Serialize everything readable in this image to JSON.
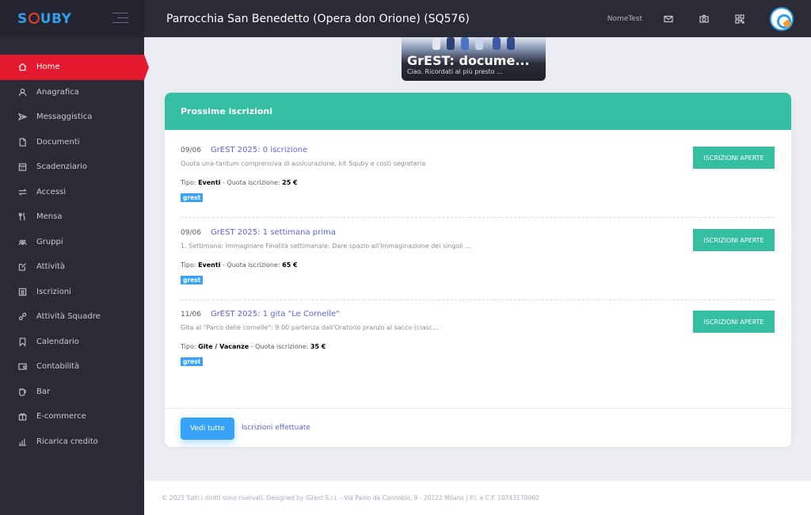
{
  "app": {
    "logo": "SQUBY"
  },
  "header": {
    "org_name": "Parrocchia San Benedetto (Opera don Orione) (SQ576)",
    "username": "NomeTest",
    "icons": [
      "mail-icon",
      "camera-icon",
      "qr-code-icon"
    ]
  },
  "sidebar": {
    "items": [
      {
        "label": "Home",
        "icon": "home-icon"
      },
      {
        "label": "Anagrafica",
        "icon": "user-icon"
      },
      {
        "label": "Messaggistica",
        "icon": "send-icon"
      },
      {
        "label": "Documenti",
        "icon": "document-icon"
      },
      {
        "label": "Scadenziario",
        "icon": "calendar-grid-icon"
      },
      {
        "label": "Accessi",
        "icon": "arrows-icon"
      },
      {
        "label": "Mensa",
        "icon": "cutlery-icon"
      },
      {
        "label": "Gruppi",
        "icon": "group-icon"
      },
      {
        "label": "Attività",
        "icon": "edit-icon"
      },
      {
        "label": "Iscrizioni",
        "icon": "list-icon"
      },
      {
        "label": "Attività Squadre",
        "icon": "link-icon"
      },
      {
        "label": "Calendario",
        "icon": "bookmark-icon"
      },
      {
        "label": "Contabilità",
        "icon": "wallet-icon"
      },
      {
        "label": "Bar",
        "icon": "cup-icon"
      },
      {
        "label": "E-commerce",
        "icon": "gift-icon"
      },
      {
        "label": "Ricarica credito",
        "icon": "chart-icon"
      }
    ]
  },
  "banner": {
    "title": "GrEST: docume...",
    "subtitle": "Ciao. Ricordati al più presto ..."
  },
  "panel": {
    "title": "Prossime iscrizioni",
    "entries": [
      {
        "date": "09/06",
        "title": "GrEST 2025: 0 iscrizione",
        "description": "Quota una-tantum comprensiva di assicurazione, kit Squby e costi segreteria",
        "type_label": "Tipo:",
        "type": "Eventi",
        "fee_label": "- Quota iscrizione:",
        "fee": "25 €",
        "tag": "grest",
        "button": "ISCRIZIONI APERTE"
      },
      {
        "date": "09/06",
        "title": "GrEST 2025: 1 settimana prima",
        "description": "1. Settimana: Immaginare Finalità settimanale: Dare spazio all'immaginazione dei singoli ...",
        "type_label": "Tipo:",
        "type": "Eventi",
        "fee_label": "- Quota iscrizione:",
        "fee": "65 €",
        "tag": "grest",
        "button": "ISCRIZIONI APERTE"
      },
      {
        "date": "11/06",
        "title": "GrEST 2025: 1 gita \"Le Cornelle\"",
        "description": "Gita al \"Parco delle cornelle\": 9:00 partenza dall'Oratorio pranzo al sacco (ciasc...",
        "type_label": "Tipo:",
        "type": "Gite / Vacanze",
        "fee_label": "- Quota iscrizione:",
        "fee": "35 €",
        "tag": "grest",
        "button": "ISCRIZIONI APERTE"
      }
    ],
    "view_all": "Vedi tutte",
    "done_link": "Iscrizioni effettuate"
  },
  "footer": {
    "text": "© 2025 Tutti i diritti sono riservati. Designed by iGrest S.r.l. - Via Paolo da Cannobio, 9 - 20122 Milano | P.I. e C.F. 10743170960"
  },
  "colors": {
    "sidebar_bg": "#2b2b36",
    "active": "#e3192e",
    "teal": "#34bfa3",
    "blue": "#36a3f7",
    "link": "#5867dd"
  }
}
